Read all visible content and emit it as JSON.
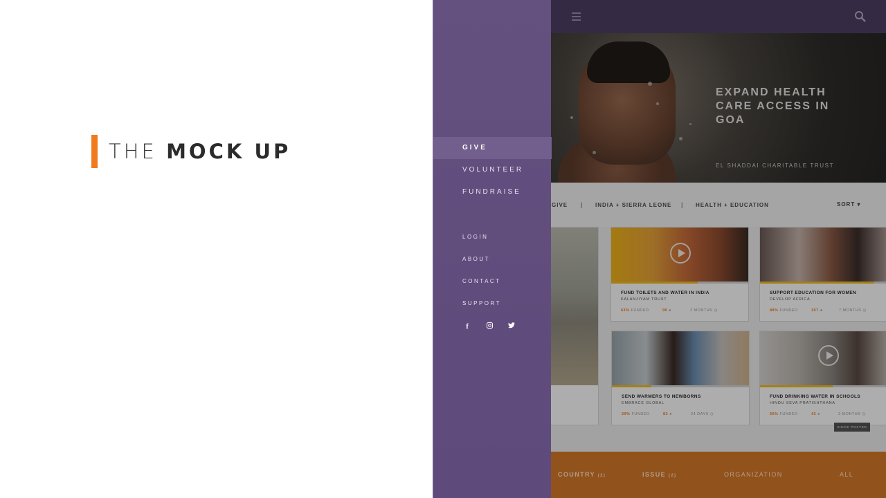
{
  "slide": {
    "title_light": "THE",
    "title_bold": "MOCK UP",
    "accent_color": "#ef7b1e"
  },
  "sidebar": {
    "primary": [
      {
        "label": "GIVE",
        "active": true
      },
      {
        "label": "VOLUNTEER",
        "active": false
      },
      {
        "label": "FUNDRAISE",
        "active": false
      }
    ],
    "secondary": [
      "LOGIN",
      "ABOUT",
      "CONTACT",
      "SUPPORT"
    ],
    "social_icons": [
      "facebook-icon",
      "instagram-icon",
      "twitter-icon"
    ],
    "bg_color": "#64517f"
  },
  "topbar": {
    "menu_icon": "hamburger-icon",
    "search_icon": "search-icon"
  },
  "hero": {
    "title": "EXPAND HEALTH CARE ACCESS IN GOA",
    "org": "EL SHADDAI CHARITABLE TRUST",
    "dots": 3
  },
  "filters": {
    "give": "GIVE",
    "countries": "INDIA + SIERRA LEONE",
    "issues": "HEALTH  + EDUCATION",
    "sort": "SORT"
  },
  "cards": [
    {
      "title": "FUND TOILETS AND WATER IN INDIA",
      "org": "KALANJIYAM TRUST",
      "funded": "63%",
      "funded_label": "FUNDED",
      "donors": "96",
      "time": "2 MONTHS",
      "progress": 0.63
    },
    {
      "title": "SUPPORT EDUCATION FOR WOMEN",
      "org": "DEVELOP AFRICA",
      "funded": "88%",
      "funded_label": "FUNDED",
      "donors": "107",
      "time": "7 MONTHS",
      "progress": 0.88
    },
    {
      "title": "SEND WARMERS TO NEWBORNS",
      "org": "EMBRACE GLOBAL",
      "funded": "29%",
      "funded_label": "FUNDED",
      "donors": "82",
      "time": "24 DAYS",
      "progress": 0.29
    },
    {
      "title": "FUND DRINKING WATER IN SCHOOLS",
      "org": "HINDU SEVA PRATISHTHANA",
      "funded": "56%",
      "funded_label": "FUNDED",
      "donors": "42",
      "time": "3 MONTHS",
      "progress": 0.56
    }
  ],
  "tooltip": "SINCE POSTED",
  "footer": {
    "country": "COUNTRY",
    "country_count": "(2)",
    "issue": "ISSUE",
    "issue_count": "(2)",
    "organization": "ORGANIZATION",
    "all": "ALL",
    "color": "#d77a2a"
  }
}
